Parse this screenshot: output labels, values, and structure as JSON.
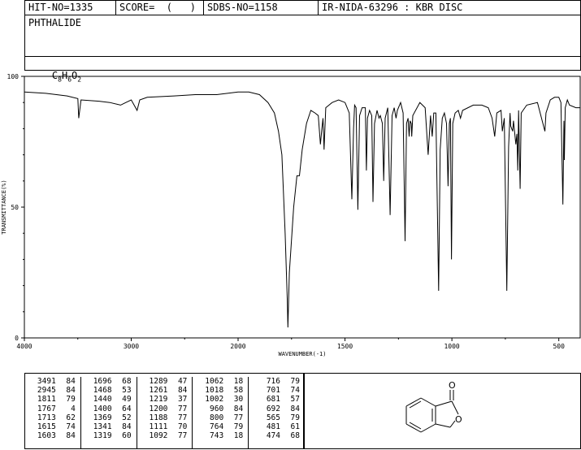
{
  "header": {
    "hit_no": "HIT-NO=1335",
    "score": "SCORE=  (   )",
    "sdbs_no": "SDBS-NO=1158",
    "ir_nida": "IR-NIDA-63296 : KBR DISC"
  },
  "compound": {
    "name": "PHTHALIDE",
    "formula_parts": {
      "c": "C",
      "c_n": "8",
      "h": "H",
      "h_n": "6",
      "o": "O",
      "o_n": "2"
    }
  },
  "colors": {
    "line": "#000000",
    "background": "#ffffff"
  },
  "chart_data": {
    "type": "line",
    "xlabel": "WAVENUMBER(-1)",
    "ylabel": "TRANSMITTANCE(%)",
    "xlim": [
      4000,
      400
    ],
    "ylim": [
      0,
      100
    ],
    "x_ticks": [
      "4000",
      "3000",
      "2000",
      "1500",
      "1000",
      "500"
    ],
    "x_tick_values": [
      4000,
      3000,
      2000,
      1500,
      1000,
      500
    ],
    "x_axis_breakpoint": 2000,
    "y_ticks": [
      "0",
      "50",
      "100"
    ],
    "y_tick_values": [
      0,
      50,
      100
    ],
    "series": [
      {
        "values": [
          [
            4000,
            94
          ],
          [
            3800,
            93.5
          ],
          [
            3600,
            92.5
          ],
          [
            3500,
            91.5
          ],
          [
            3491,
            84
          ],
          [
            3470,
            91
          ],
          [
            3300,
            90.5
          ],
          [
            3200,
            90
          ],
          [
            3100,
            89
          ],
          [
            3050,
            90
          ],
          [
            3000,
            91
          ],
          [
            2945,
            87
          ],
          [
            2920,
            91
          ],
          [
            2850,
            92
          ],
          [
            2600,
            92.5
          ],
          [
            2400,
            93
          ],
          [
            2300,
            93
          ],
          [
            2200,
            93
          ],
          [
            2100,
            93.5
          ],
          [
            2000,
            94
          ],
          [
            1950,
            94
          ],
          [
            1900,
            93
          ],
          [
            1860,
            90
          ],
          [
            1830,
            86
          ],
          [
            1811,
            79
          ],
          [
            1795,
            70
          ],
          [
            1780,
            40
          ],
          [
            1770,
            15
          ],
          [
            1767,
            4
          ],
          [
            1760,
            25
          ],
          [
            1740,
            50
          ],
          [
            1725,
            62
          ],
          [
            1713,
            62
          ],
          [
            1700,
            72
          ],
          [
            1680,
            82
          ],
          [
            1660,
            87
          ],
          [
            1640,
            86
          ],
          [
            1625,
            85
          ],
          [
            1615,
            74
          ],
          [
            1608,
            80
          ],
          [
            1603,
            84
          ],
          [
            1598,
            72
          ],
          [
            1590,
            88
          ],
          [
            1560,
            90
          ],
          [
            1530,
            91
          ],
          [
            1500,
            90
          ],
          [
            1480,
            86
          ],
          [
            1468,
            53
          ],
          [
            1460,
            80
          ],
          [
            1455,
            89
          ],
          [
            1448,
            88
          ],
          [
            1440,
            49
          ],
          [
            1432,
            85
          ],
          [
            1420,
            88
          ],
          [
            1405,
            88
          ],
          [
            1400,
            64
          ],
          [
            1395,
            84
          ],
          [
            1385,
            87
          ],
          [
            1375,
            85
          ],
          [
            1369,
            52
          ],
          [
            1362,
            82
          ],
          [
            1350,
            87
          ],
          [
            1341,
            84
          ],
          [
            1335,
            85
          ],
          [
            1325,
            82
          ],
          [
            1319,
            60
          ],
          [
            1312,
            84
          ],
          [
            1300,
            88
          ],
          [
            1289,
            47
          ],
          [
            1280,
            85
          ],
          [
            1270,
            88
          ],
          [
            1261,
            84
          ],
          [
            1255,
            87
          ],
          [
            1240,
            90
          ],
          [
            1228,
            86
          ],
          [
            1219,
            37
          ],
          [
            1212,
            82
          ],
          [
            1205,
            84
          ],
          [
            1200,
            77
          ],
          [
            1196,
            83
          ],
          [
            1190,
            82
          ],
          [
            1188,
            77
          ],
          [
            1183,
            85
          ],
          [
            1150,
            90
          ],
          [
            1125,
            88
          ],
          [
            1111,
            70
          ],
          [
            1100,
            85
          ],
          [
            1092,
            77
          ],
          [
            1085,
            86
          ],
          [
            1075,
            86
          ],
          [
            1062,
            18
          ],
          [
            1055,
            72
          ],
          [
            1045,
            84
          ],
          [
            1035,
            86
          ],
          [
            1025,
            82
          ],
          [
            1018,
            58
          ],
          [
            1012,
            82
          ],
          [
            1007,
            84
          ],
          [
            1002,
            30
          ],
          [
            996,
            82
          ],
          [
            985,
            86
          ],
          [
            970,
            87
          ],
          [
            960,
            84
          ],
          [
            950,
            87
          ],
          [
            900,
            89
          ],
          [
            860,
            89
          ],
          [
            830,
            88
          ],
          [
            812,
            84
          ],
          [
            800,
            77
          ],
          [
            790,
            86
          ],
          [
            770,
            87
          ],
          [
            764,
            79
          ],
          [
            755,
            84
          ],
          [
            743,
            18
          ],
          [
            735,
            73
          ],
          [
            728,
            86
          ],
          [
            725,
            81
          ],
          [
            716,
            79
          ],
          [
            712,
            83
          ],
          [
            701,
            74
          ],
          [
            696,
            78
          ],
          [
            692,
            64
          ],
          [
            688,
            87
          ],
          [
            681,
            57
          ],
          [
            676,
            86
          ],
          [
            650,
            89
          ],
          [
            600,
            90
          ],
          [
            565,
            79
          ],
          [
            560,
            86
          ],
          [
            540,
            91
          ],
          [
            520,
            92
          ],
          [
            500,
            92
          ],
          [
            490,
            90
          ],
          [
            481,
            51
          ],
          [
            476,
            83
          ],
          [
            474,
            68
          ],
          [
            470,
            88
          ],
          [
            460,
            91
          ],
          [
            450,
            89
          ],
          [
            420,
            88
          ],
          [
            400,
            88
          ]
        ]
      }
    ]
  },
  "peak_table": [
    [
      [
        "3491",
        "84"
      ],
      [
        "2945",
        "84"
      ],
      [
        "1811",
        "79"
      ],
      [
        "1767",
        "4"
      ],
      [
        "1713",
        "62"
      ],
      [
        "1615",
        "74"
      ],
      [
        "1603",
        "84"
      ]
    ],
    [
      [
        "1696",
        "68"
      ],
      [
        "1468",
        "53"
      ],
      [
        "1440",
        "49"
      ],
      [
        "1400",
        "64"
      ],
      [
        "1369",
        "52"
      ],
      [
        "1341",
        "84"
      ],
      [
        "1319",
        "60"
      ]
    ],
    [
      [
        "1289",
        "47"
      ],
      [
        "1261",
        "84"
      ],
      [
        "1219",
        "37"
      ],
      [
        "1200",
        "77"
      ],
      [
        "1188",
        "77"
      ],
      [
        "1111",
        "70"
      ],
      [
        "1092",
        "77"
      ]
    ],
    [
      [
        "1062",
        "18"
      ],
      [
        "1018",
        "58"
      ],
      [
        "1002",
        "30"
      ],
      [
        "960",
        "84"
      ],
      [
        "800",
        "77"
      ],
      [
        "764",
        "79"
      ],
      [
        "743",
        "18"
      ]
    ],
    [
      [
        "716",
        "79"
      ],
      [
        "701",
        "74"
      ],
      [
        "681",
        "57"
      ],
      [
        "692",
        "84"
      ],
      [
        "565",
        "79"
      ],
      [
        "481",
        "61"
      ],
      [
        "474",
        "68"
      ]
    ]
  ],
  "structure": {
    "carbonyl_o": "O",
    "ring_o": "O"
  }
}
